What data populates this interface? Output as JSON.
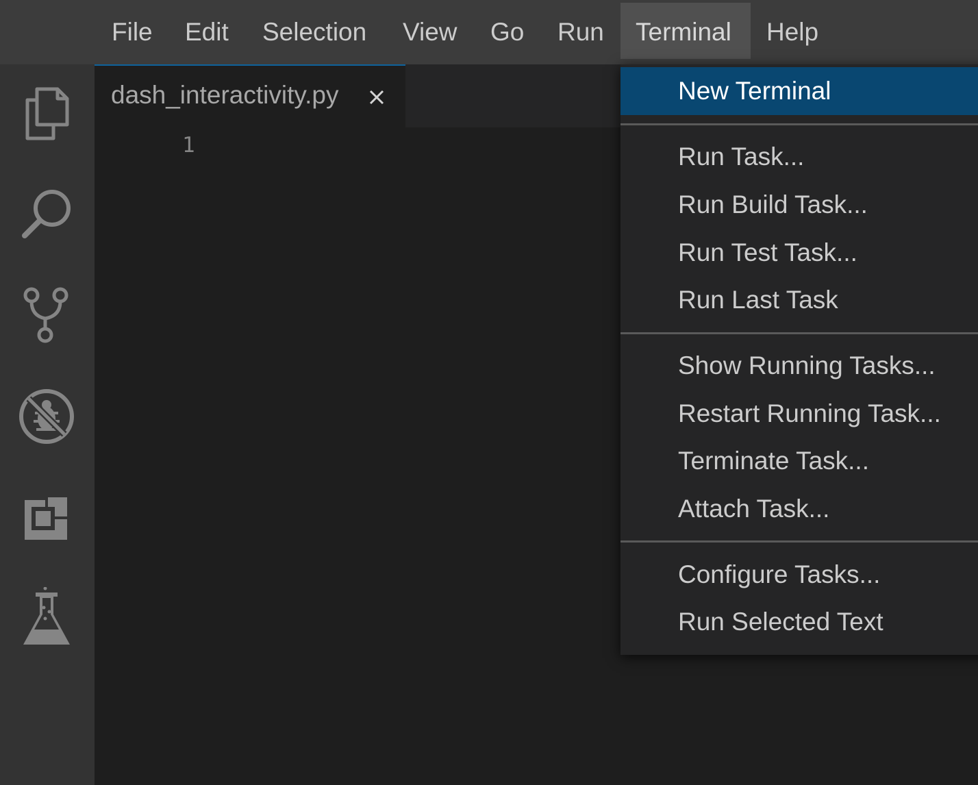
{
  "menubar": {
    "items": [
      {
        "label": "File"
      },
      {
        "label": "Edit"
      },
      {
        "label": "Selection"
      },
      {
        "label": "View"
      },
      {
        "label": "Go"
      },
      {
        "label": "Run"
      },
      {
        "label": "Terminal",
        "active": true
      },
      {
        "label": "Help"
      }
    ]
  },
  "activitybar": {
    "icons": [
      "explorer-icon",
      "search-icon",
      "source-control-icon",
      "run-debug-icon",
      "extensions-icon",
      "testing-icon"
    ]
  },
  "tabs": [
    {
      "label": "dash_interactivity.py",
      "close_icon": "close-icon"
    }
  ],
  "editor": {
    "line_numbers": [
      "1"
    ]
  },
  "terminal_menu": {
    "items": [
      {
        "label": "New Terminal",
        "selected": true
      },
      {
        "label": "Run Task..."
      },
      {
        "label": "Run Build Task..."
      },
      {
        "label": "Run Test Task..."
      },
      {
        "label": "Run Last Task"
      },
      {
        "label": "Show Running Tasks..."
      },
      {
        "label": "Restart Running Task..."
      },
      {
        "label": "Terminate Task..."
      },
      {
        "label": "Attach Task..."
      },
      {
        "label": "Configure Tasks..."
      },
      {
        "label": "Run Selected Text"
      }
    ]
  },
  "colors": {
    "menubar_bg": "#3c3c3c",
    "activitybar_bg": "#333333",
    "editor_bg": "#1e1e1e",
    "menu_bg": "#252526",
    "selection_bg": "#094771",
    "tab_accent": "#0e639c"
  }
}
